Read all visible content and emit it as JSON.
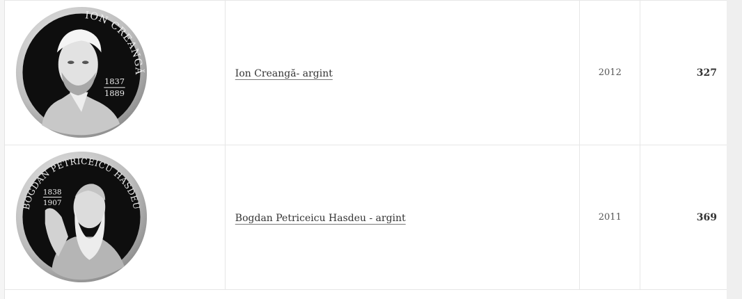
{
  "rows": [
    {
      "name": "Ion Creangă- argint",
      "year": "2012",
      "price": "327",
      "coin": {
        "legend": "ION CREANGĂ",
        "year_from": "1837",
        "year_to": "1889"
      }
    },
    {
      "name": "Bogdan Petriceicu Hasdeu - argint",
      "year": "2011",
      "price": "369",
      "coin": {
        "legend": "BOGDAN PETRICEICU HASDEU",
        "year_from": "1838",
        "year_to": "1907"
      }
    }
  ],
  "colors": {
    "coin_field": "#0e0e0e",
    "coin_rim": "#c9c9c9",
    "link_underline": "#777777"
  }
}
